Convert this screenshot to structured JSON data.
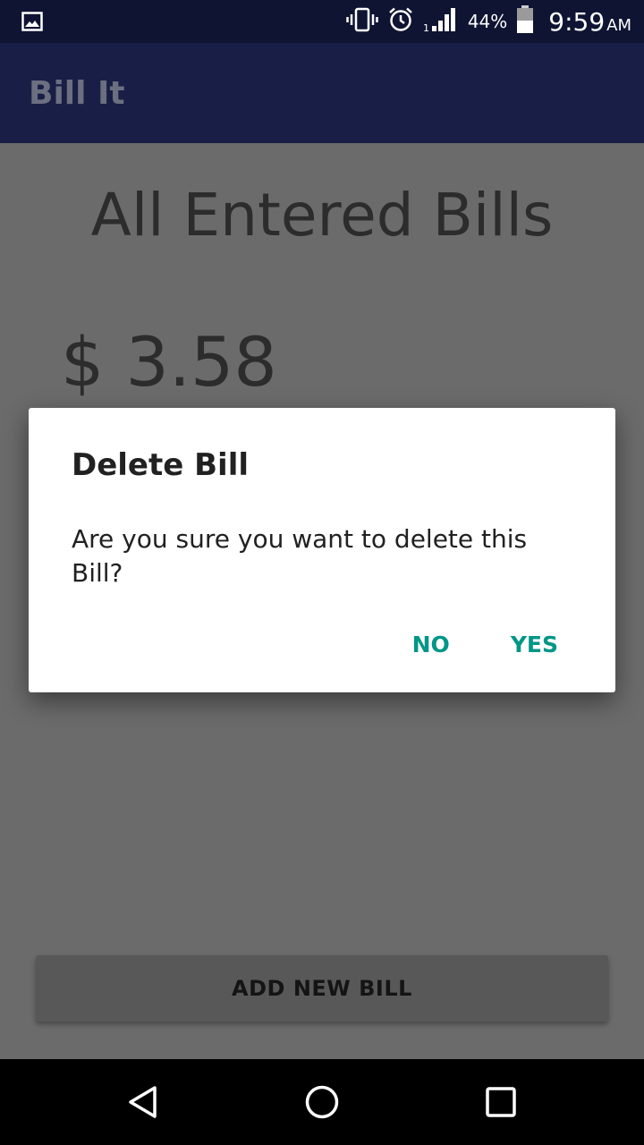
{
  "status_bar": {
    "battery_percent": "44%",
    "time": "9:59",
    "ampm": "AM",
    "signal_sim": "1",
    "icons": [
      "image-icon",
      "vibrate-icon",
      "alarm-icon",
      "signal-icon",
      "battery-icon"
    ]
  },
  "app_bar": {
    "title": "Bill It"
  },
  "content": {
    "heading": "All Entered Bills",
    "bill_amount": "$ 3.58",
    "add_button_label": "ADD NEW BILL"
  },
  "dialog": {
    "title": "Delete Bill",
    "message": "Are you sure you want to delete this Bill?",
    "no_label": "NO",
    "yes_label": "YES"
  },
  "nav_bar": {
    "icons": [
      "back-icon",
      "home-icon",
      "recents-icon"
    ]
  },
  "colors": {
    "status_bar": "#0f1433",
    "app_bar": "#181e45",
    "dialog_accent": "#009688",
    "scrim_background": "#6b6b6b"
  }
}
